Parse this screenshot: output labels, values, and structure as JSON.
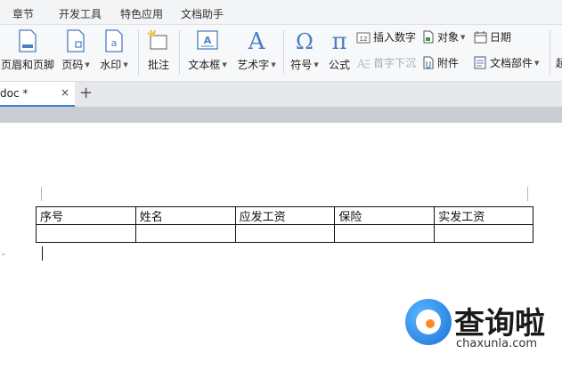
{
  "menu": {
    "items": [
      "章节",
      "开发工具",
      "特色应用",
      "文档助手"
    ]
  },
  "ribbon": {
    "header_footer": "页眉和页脚",
    "page_number": "页码",
    "watermark": "水印",
    "comment": "批注",
    "text_box": "文本框",
    "word_art": "艺术字",
    "symbol": "符号",
    "formula": "公式",
    "insert_number": "插入数字",
    "drop_cap": "首字下沉",
    "object": "对象",
    "attachment": "附件",
    "date": "日期",
    "doc_parts": "文档部件",
    "cut_off": "超"
  },
  "tabs": {
    "doc_name": "doc *",
    "close": "×",
    "new": "+"
  },
  "table": {
    "headers": [
      "序号",
      "姓名",
      "应发工资",
      "保险",
      "实发工资"
    ],
    "empty_row": [
      "",
      "",
      "",
      "",
      ""
    ]
  },
  "watermark": {
    "brand": "查询啦",
    "url": "chaxunla.com"
  },
  "colors": {
    "accent_blue": "#3b7ddd",
    "icon_blue": "#4a7fc1",
    "watermark_blue": "#1b6fd8",
    "watermark_orange": "#ff8a1c"
  }
}
